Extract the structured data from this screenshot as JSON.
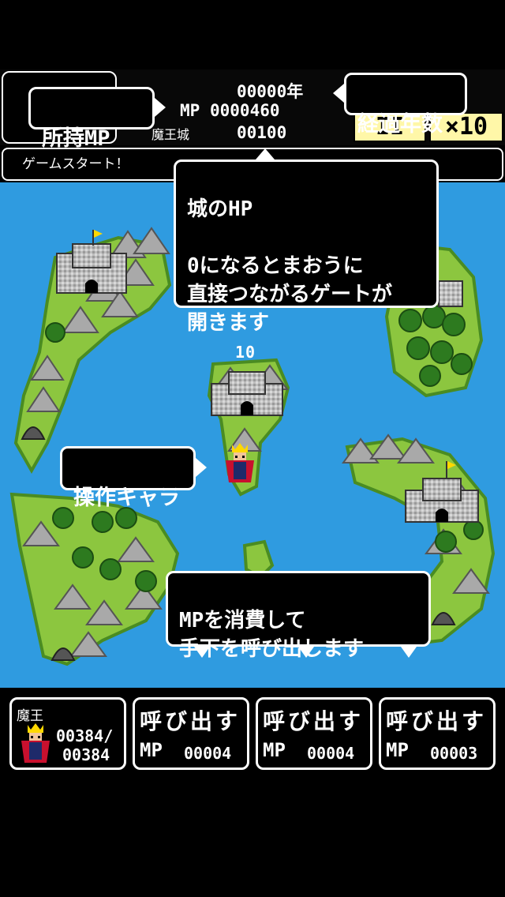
{
  "header": {
    "years_value": "00000年",
    "mp_label": "MP",
    "mp_value": "0000460",
    "castle_label": "魔王城",
    "castle_value": "00100",
    "pause_label": "II",
    "speed_label": "×10"
  },
  "log": {
    "message": "ゲームスタート！"
  },
  "tutorial": {
    "mp_bubble": "所持MP",
    "years_bubble": "経過年数",
    "castle_hp_bubble": "城のHP\n\n0になるとまおうに\n直接つながるゲートが\n開きます",
    "character_bubble": "操作キャラ",
    "summon_bubble": "MPを消費して\n手下を呼び出します"
  },
  "map": {
    "castle_hp_marker": "10"
  },
  "bottom": {
    "hero": {
      "name": "魔王",
      "hp_current": "00384/",
      "hp_max": "00384"
    },
    "summons": [
      {
        "title": "呼び出す",
        "mp_label": "MP",
        "cost": "00004"
      },
      {
        "title": "呼び出す",
        "mp_label": "MP",
        "cost": "00004"
      },
      {
        "title": "呼び出す",
        "mp_label": "MP",
        "cost": "00003"
      }
    ]
  },
  "colors": {
    "sea": "#2f9be0",
    "land": "#8cc63f",
    "land_dark": "#4a8c22",
    "speed_bg": "#fff7a8"
  }
}
